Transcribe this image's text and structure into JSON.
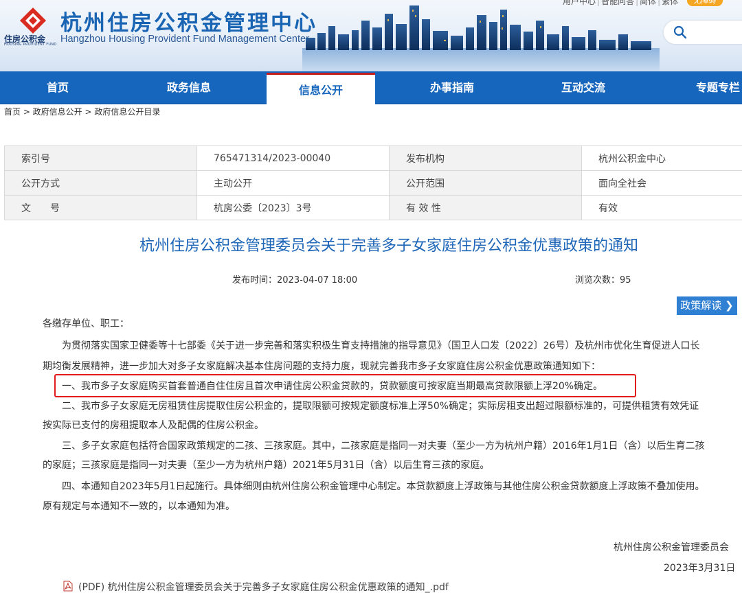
{
  "header": {
    "logo_cn": "杭州住房公积金管理中心",
    "logo_en": "Hangzhou Housing Provident Fund Management Center",
    "logo_small_cn": "住房公积金",
    "logo_small_en": "HOUSING PROVIDENT FUND",
    "top_links": [
      "用户中心",
      "智能问答",
      "简体",
      "繁体"
    ],
    "elder_badge": "无障碍",
    "search_icon": "search-icon"
  },
  "nav": {
    "items": [
      "首页",
      "政务信息",
      "信息公开",
      "办事指南",
      "互动交流",
      "专题专栏"
    ],
    "active": "信息公开"
  },
  "breadcrumb": "首页 > 政府信息公开 > 政府信息公开目录",
  "meta": {
    "rows": [
      {
        "l1": "索引号",
        "v1": "765471314/2023-00040",
        "l2": "发布机构",
        "v2": "杭州公积金中心"
      },
      {
        "l1": "公开方式",
        "v1": "主动公开",
        "l2": "公开范围",
        "v2": "面向全社会"
      },
      {
        "l1": "文　　号",
        "v1": "杭房公委〔2023〕3号",
        "l2": "有 效 性",
        "v2": "有效"
      }
    ]
  },
  "article": {
    "title": "杭州住房公积金管理委员会关于完善多子女家庭住房公积金优惠政策的通知",
    "pubtime": "发布时间：2023-04-07 18:00",
    "views": "浏览次数：95",
    "policy_button": "政策解读 ❯",
    "lines": [
      "各缴存单位、职工：",
      "　　为贯彻落实国家卫健委等十七部委《关于进一步完善和落实积极生育支持措施的指导意见》（国卫人口发〔2022〕26号）及杭州市优化生育促进人口长",
      "期均衡发展精神，进一步加大对多子女家庭解决基本住房问题的支持力度，现就完善我市多子女家庭住房公积金优惠政策通知如下：",
      "　　一、我市多子女家庭购买首套普通自住住房且首次申请住房公积金贷款的，贷款额度可按家庭当期最高贷款限额上浮20%确定。",
      "　　二、我市多子女家庭无房租赁住房提取住房公积金的，提取限额可按规定额度标准上浮50%确定；实际房租支出超过限额标准的，可提供租赁有效凭证",
      "按实际已支付的房租提取本人及配偶的住房公积金。",
      "　　三、多子女家庭包括符合国家政策规定的二孩、三孩家庭。其中，二孩家庭是指同一对夫妻（至少一方为杭州户籍）2016年1月1日（含）以后生育二孩",
      "的家庭；三孩家庭是指同一对夫妻（至少一方为杭州户籍）2021年5月31日（含）以后生育三孩的家庭。",
      "　　四、本通知自2023年5月1日起施行。具体细则由杭州住房公积金管理中心制定。本贷款额度上浮政策与其他住房公积金贷款额度上浮政策不叠加使用。",
      "原有规定与本通知不一致的，以本通知为准。"
    ],
    "signer": "杭州住房公积金管理委员会",
    "date": "2023年3月31日",
    "attachment": "(PDF) 杭州住房公积金管理委员会关于完善多子女家庭住房公积金优惠政策的通知_.pdf"
  },
  "colors": {
    "nav_blue": "#1766bd",
    "title_blue": "#1e66b8",
    "highlight_red": "#e11b1b",
    "active_top_red": "#c81d1d"
  }
}
